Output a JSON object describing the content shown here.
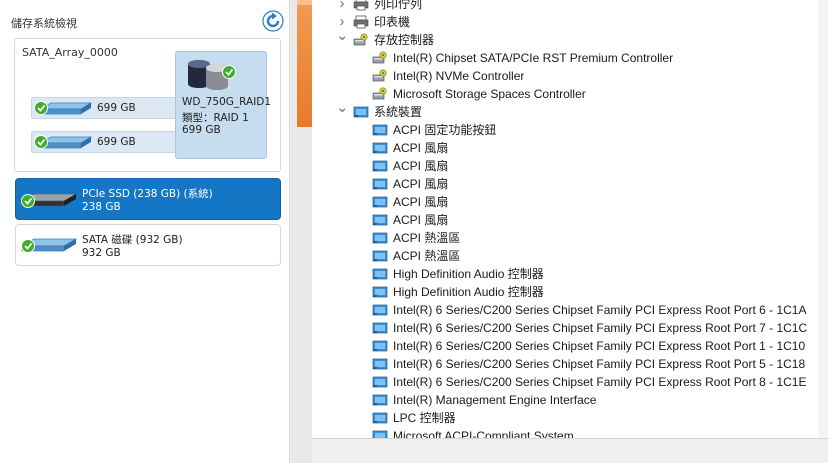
{
  "left_panel": {
    "title": "儲存系統檢視",
    "array": {
      "name": "SATA_Array_0000",
      "members": [
        {
          "size": "699 GB"
        },
        {
          "size": "699 GB"
        }
      ],
      "raid": {
        "name": "WD_750G_RAID1",
        "type": "類型：RAID 1",
        "size": "699 GB"
      }
    },
    "disks": [
      {
        "name": "PCIe SSD (238 GB) (系統)",
        "size": "238 GB",
        "selected": true
      },
      {
        "name": "SATA 磁碟 (932 GB)",
        "size": "932 GB",
        "selected": false
      }
    ]
  },
  "device_tree": {
    "rows": [
      {
        "label": "列印佇列",
        "expand": "collapsed",
        "icon": "printer-icon"
      },
      {
        "label": "印表機",
        "expand": "collapsed",
        "icon": "printer-icon"
      },
      {
        "label": "存放控制器",
        "expand": "expanded",
        "icon": "storage-controller-icon"
      },
      {
        "label": "Intel(R) Chipset SATA/PCIe RST Premium Controller",
        "expand": "none",
        "icon": "storage-controller-icon"
      },
      {
        "label": "Intel(R) NVMe Controller",
        "expand": "none",
        "icon": "storage-controller-icon"
      },
      {
        "label": "Microsoft Storage Spaces Controller",
        "expand": "none",
        "icon": "storage-controller-icon"
      },
      {
        "label": "系統裝置",
        "expand": "expanded",
        "icon": "system-device-icon"
      },
      {
        "label": "ACPI 固定功能按鈕",
        "expand": "none",
        "icon": "system-device-icon"
      },
      {
        "label": "ACPI 風扇",
        "expand": "none",
        "icon": "system-device-icon"
      },
      {
        "label": "ACPI 風扇",
        "expand": "none",
        "icon": "system-device-icon"
      },
      {
        "label": "ACPI 風扇",
        "expand": "none",
        "icon": "system-device-icon"
      },
      {
        "label": "ACPI 風扇",
        "expand": "none",
        "icon": "system-device-icon"
      },
      {
        "label": "ACPI 風扇",
        "expand": "none",
        "icon": "system-device-icon"
      },
      {
        "label": "ACPI 熱溫區",
        "expand": "none",
        "icon": "system-device-icon"
      },
      {
        "label": "ACPI 熱溫區",
        "expand": "none",
        "icon": "system-device-icon"
      },
      {
        "label": "High Definition Audio 控制器",
        "expand": "none",
        "icon": "system-device-icon"
      },
      {
        "label": "High Definition Audio 控制器",
        "expand": "none",
        "icon": "system-device-icon"
      },
      {
        "label": "Intel(R) 6 Series/C200 Series Chipset Family PCI Express Root Port 6 - 1C1A",
        "expand": "none",
        "icon": "system-device-icon"
      },
      {
        "label": "Intel(R) 6 Series/C200 Series Chipset Family PCI Express Root Port 7 - 1C1C",
        "expand": "none",
        "icon": "system-device-icon"
      },
      {
        "label": "Intel(R) 6 Series/C200 Series Chipset Family PCI Express Root Port 1 - 1C10",
        "expand": "none",
        "icon": "system-device-icon"
      },
      {
        "label": "Intel(R) 6 Series/C200 Series Chipset Family PCI Express Root Port 5 - 1C18",
        "expand": "none",
        "icon": "system-device-icon"
      },
      {
        "label": "Intel(R) 6 Series/C200 Series Chipset Family PCI Express Root Port 8 - 1C1E",
        "expand": "none",
        "icon": "system-device-icon"
      },
      {
        "label": "Intel(R) Management Engine Interface",
        "expand": "none",
        "icon": "system-device-icon"
      },
      {
        "label": "LPC 控制器",
        "expand": "none",
        "icon": "system-device-icon"
      },
      {
        "label": "Microsoft ACPI-Compliant System",
        "expand": "none",
        "icon": "system-device-icon"
      }
    ]
  },
  "colors": {
    "selected": "#1477c6",
    "raid_card": "#c6dcef",
    "check_green": "#3fae2a",
    "accent_orange": "#e67b2a"
  }
}
